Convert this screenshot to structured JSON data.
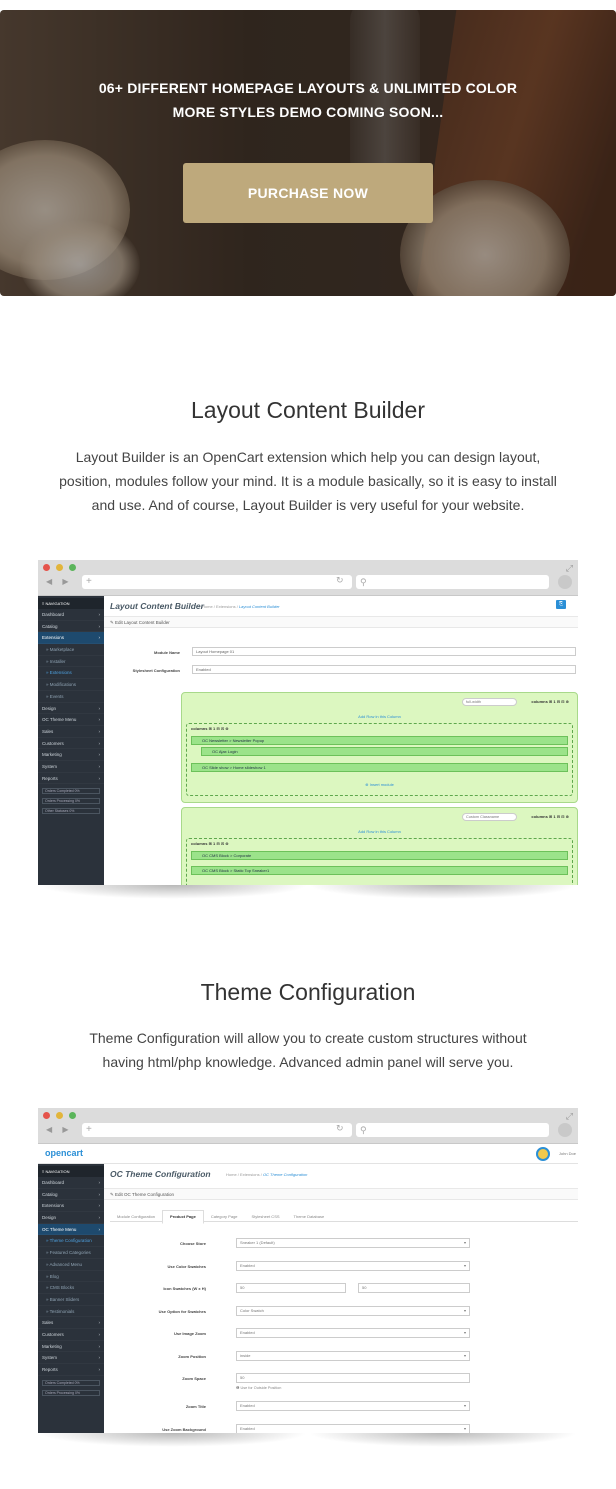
{
  "hero": {
    "line1": "06+ DIFFERENT HOMEPAGE LAYOUTS & UNLIMITED COLOR",
    "line2": "MORE STYLES DEMO COMING SOON...",
    "button": "PURCHASE NOW",
    "button_color": "#bea97c"
  },
  "layout_section": {
    "title": "Layout Content Builder",
    "desc_line1": "Layout Builder is an OpenCart extension which help you can design layout,",
    "desc_line2": "position, modules follow your mind. It is a module basically, so it is easy to install",
    "desc_line3": "and use. And of course, Layout Builder is very useful for your website."
  },
  "browser": {
    "nav_buttons": "◀ ▶",
    "new_tab": "+",
    "refresh_icon": "↻"
  },
  "shot1": {
    "nav_head": "≡ NAVIGATION",
    "sidebar": [
      {
        "label": "Dashboard",
        "type": "it"
      },
      {
        "label": "Catalog",
        "type": "it"
      },
      {
        "label": "Extensions",
        "type": "act"
      },
      {
        "label": "» Marketplace",
        "type": "sub"
      },
      {
        "label": "» Installer",
        "type": "sub"
      },
      {
        "label": "» Extensions",
        "type": "subact"
      },
      {
        "label": "» Modifications",
        "type": "sub"
      },
      {
        "label": "» Events",
        "type": "sub"
      },
      {
        "label": "Design",
        "type": "it"
      },
      {
        "label": "OC Theme Menu",
        "type": "it"
      },
      {
        "label": "Sales",
        "type": "it"
      },
      {
        "label": "Customers",
        "type": "it"
      },
      {
        "label": "Marketing",
        "type": "it"
      },
      {
        "label": "System",
        "type": "it"
      },
      {
        "label": "Reports",
        "type": "it"
      }
    ],
    "progress": [
      "Orders Completed  0%",
      "Orders Processing  0%",
      "Other Statuses  0%"
    ],
    "page_title": "Layout Content Builder",
    "crumb_home": "Home",
    "crumb_ext": "Extensions",
    "crumb_current": "Layout Content Builder",
    "panel_heading": "✎ Edit Layout Content Builder",
    "module_name_label": "Module Name",
    "module_name_value": "Layout Homepage 01",
    "stylesheet_label": "Stylesheet Configuration",
    "stylesheet_value": "Enabled",
    "row1_width": "full-width",
    "row2_width": "Custom Classname",
    "columns_ctrl": "columns ⊞ 1 ⊟ ⊡ ⊗",
    "add_row": "Add Row in this Column",
    "col_label": "columns ⊞ 1 ⊟ ⊡ ⊗",
    "modules_row1": [
      "OC Newsletter > Newsletter Popup",
      "OC Ajax Login",
      "OC Slide show > Home slideshow 1"
    ],
    "modules_row2": [
      "OC CMS Block > Corporate",
      "OC CMS Block > Static Top Sneaker1"
    ],
    "insert_module": "⊕ Insert module"
  },
  "theme_section": {
    "title": "Theme Configuration",
    "desc_line1": "Theme Configuration will allow you to create custom structures without",
    "desc_line2": "having html/php knowledge. Advanced admin panel will serve you."
  },
  "shot2": {
    "logo": "opencart",
    "user": "John Doe",
    "nav_head": "≡ NAVIGATION",
    "sidebar": [
      {
        "label": "Dashboard",
        "type": "it"
      },
      {
        "label": "Catalog",
        "type": "it"
      },
      {
        "label": "Extensions",
        "type": "it"
      },
      {
        "label": "Design",
        "type": "it"
      },
      {
        "label": "OC Theme Menu",
        "type": "act"
      },
      {
        "label": "» Theme Configuration",
        "type": "subact"
      },
      {
        "label": "» Featured Categories",
        "type": "sub"
      },
      {
        "label": "» Advanced Menu",
        "type": "sub"
      },
      {
        "label": "» Blog",
        "type": "sub"
      },
      {
        "label": "» CMS Blocks",
        "type": "sub"
      },
      {
        "label": "» Banner Sliders",
        "type": "sub"
      },
      {
        "label": "» Testimonials",
        "type": "sub"
      },
      {
        "label": "Sales",
        "type": "it"
      },
      {
        "label": "Customers",
        "type": "it"
      },
      {
        "label": "Marketing",
        "type": "it"
      },
      {
        "label": "System",
        "type": "it"
      },
      {
        "label": "Reports",
        "type": "it"
      }
    ],
    "progress": [
      "Orders Completed  0%",
      "Orders Processing  0%"
    ],
    "page_title": "OC Theme Configuration",
    "crumb_home": "Home",
    "crumb_ext": "Extensions",
    "crumb_current": "OC Theme Configuration",
    "panel_heading": "✎ Edit OC Theme Configuration",
    "tabs": [
      "Module Configuration",
      "Product Page",
      "Category Page",
      "Stylesheet CSS",
      "Theme Database"
    ],
    "fields": [
      {
        "label": "Choose Store",
        "value": "Sneaker 1 (Default)",
        "kind": "select"
      },
      {
        "label": "Use Color Swatches",
        "value": "Enabled",
        "kind": "select"
      },
      {
        "label": "Icon Swatches (W x H)",
        "value": "50",
        "value2": "50",
        "kind": "pair"
      },
      {
        "label": "Use Option for Swatches",
        "value": "Color Swatch",
        "kind": "select"
      },
      {
        "label": "Use Image Zoom",
        "value": "Enabled",
        "kind": "select"
      },
      {
        "label": "Zoom Position",
        "value": "inside",
        "kind": "select"
      },
      {
        "label": "Zoom Space",
        "value": "50",
        "kind": "text",
        "hint": "❶ Use for Outside Position"
      },
      {
        "label": "Zoom Title",
        "value": "Enabled",
        "kind": "select"
      },
      {
        "label": "Use Zoom Background",
        "value": "Enabled",
        "kind": "select"
      }
    ]
  }
}
